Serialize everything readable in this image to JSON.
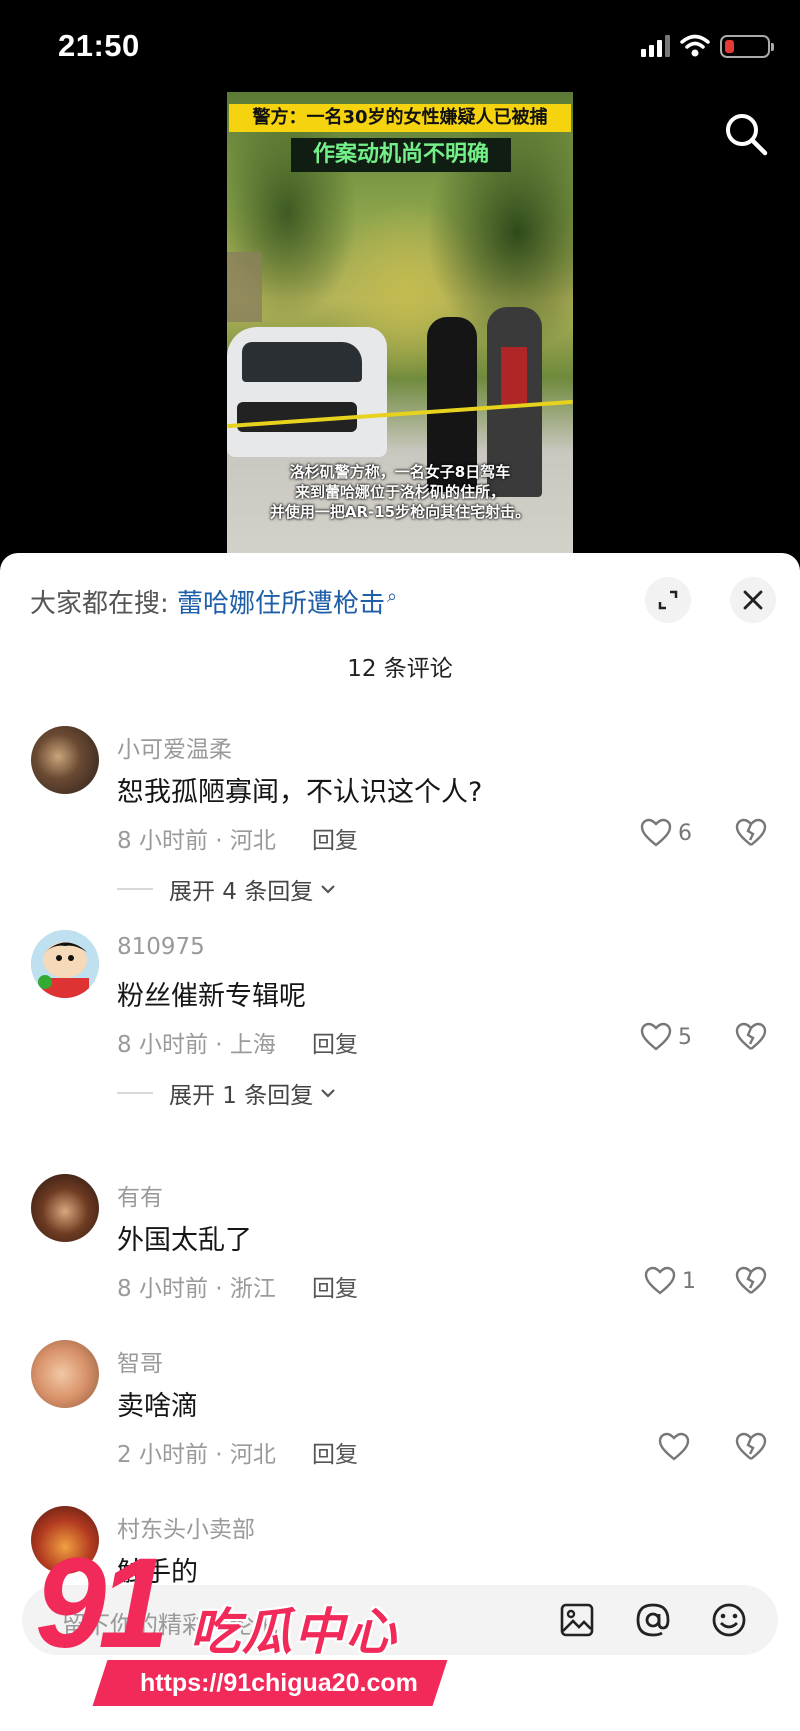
{
  "status_bar": {
    "time": "21:50"
  },
  "video": {
    "caption_top": "警方：一名30岁的女性嫌疑人已被捕",
    "caption_mid": "作案动机尚不明确",
    "caption_bottom_1": "洛杉矶警方称，一名女子8日驾车",
    "caption_bottom_2": "来到蕾哈娜位于洛杉矶的住所，",
    "caption_bottom_3": "并使用一把AR-15步枪向其住宅射击。"
  },
  "comments_sheet": {
    "trend_prefix": "大家都在搜:",
    "trend_link": "蕾哈娜住所遭枪击",
    "comment_count": "12 条评论",
    "reply_label": "回复",
    "comments": [
      {
        "user": "小可爱温柔",
        "text": "恕我孤陋寡闻，不认识这个人?",
        "meta": "8 小时前 · 河北",
        "likes": "6",
        "expand": "展开 4 条回复"
      },
      {
        "user": "810975",
        "text": "粉丝催新专辑呢",
        "meta": "8 小时前 · 上海",
        "likes": "5",
        "expand": "展开 1 条回复"
      },
      {
        "user": "有有",
        "text": "外国太乱了",
        "meta": "8 小时前 · 浙江",
        "likes": "1"
      },
      {
        "user": "智哥",
        "text": "卖啥滴",
        "meta": "2 小时前 · 河北",
        "likes": ""
      },
      {
        "user": "村东头小卖部",
        "text": "触手的"
      }
    ],
    "input_placeholder": "留下你的精彩评论吧"
  },
  "watermark": {
    "brand_number": "91",
    "brand_name": "吃瓜中心",
    "url": "https://91chigua20.com"
  },
  "colors": {
    "accent_link": "#1f5fa8",
    "watermark": "#f22a5a",
    "battery_low": "#e53935"
  }
}
